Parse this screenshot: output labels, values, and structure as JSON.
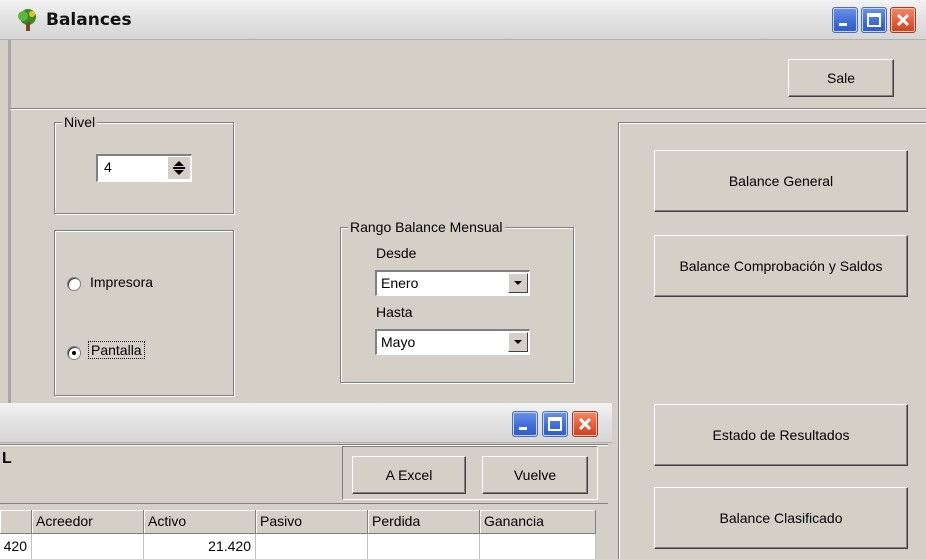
{
  "window": {
    "title": "Balances",
    "exit_label": "Sale"
  },
  "nivel": {
    "label": "Nivel",
    "value": "4"
  },
  "output": {
    "options": [
      "Impresora",
      "Pantalla"
    ],
    "selected": "Pantalla"
  },
  "rango": {
    "label": "Rango Balance Mensual",
    "desde_label": "Desde",
    "desde_value": "Enero",
    "hasta_label": "Hasta",
    "hasta_value": "Mayo"
  },
  "reports": {
    "balance_general": "Balance General",
    "balance_comprobacion": "Balance Comprobación y Saldos",
    "estado_resultados": "Estado de Resultados",
    "balance_clasificado": "Balance Clasificado"
  },
  "child_window": {
    "heading_fragment": "L",
    "excel_label": "A Excel",
    "back_label": "Vuelve",
    "columns": [
      "Acreedor",
      "Activo",
      "Pasivo",
      "Perdida",
      "Ganancia"
    ],
    "row": {
      "first_fragment": "420",
      "acreedor": "",
      "activo": "21.420",
      "pasivo": "",
      "perdida": "",
      "ganancia": ""
    }
  },
  "colors": {
    "window_bg": "#d4d0c8",
    "xp_blue": "#3d6bd8",
    "xp_close": "#e25a3a"
  }
}
